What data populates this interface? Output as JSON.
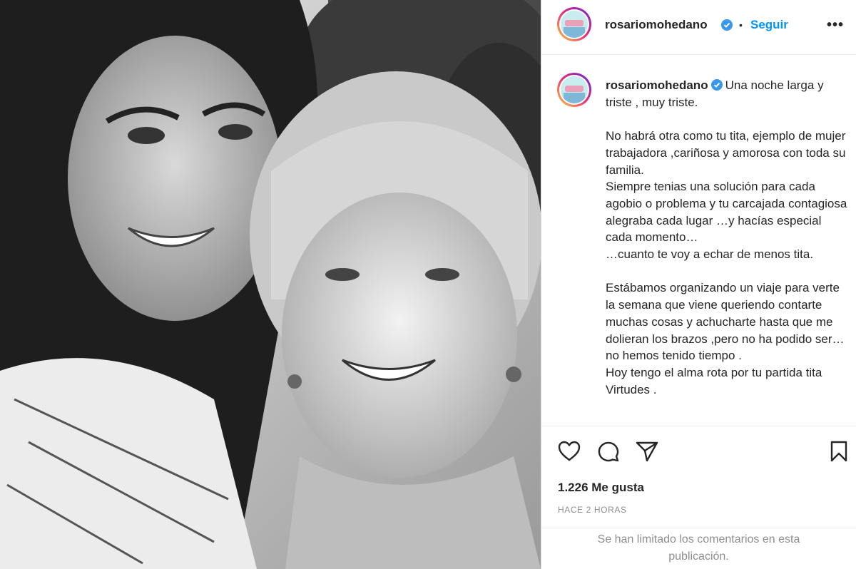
{
  "post": {
    "username": "rosariomohedano",
    "verified": true,
    "follow_label": "Seguir",
    "separator": "•",
    "more_label": "•••",
    "caption_text": "Una noche larga y triste , muy triste.\n\nNo habrá otra como tu tita, ejemplo de mujer trabajadora ,cariñosa y amorosa con toda su familia.\nSiempre tenias una solución para cada agobio o problema y tu carcajada contagiosa alegraba cada lugar …y hacías especial cada momento…\n…cuanto te voy a echar de menos tita.\n\nEstábamos organizando un viaje para verte la semana que viene queriendo contarte muchas cosas y achucharte hasta que me dolieran los brazos ,pero no ha podido ser…no hemos tenido tiempo .\nHoy tengo el alma rota por tu partida tita Virtudes .",
    "likes": "1.226 Me gusta",
    "time": "HACE 2 HORAS",
    "comments_limited": [
      "Se han limitado los comentarios en esta",
      "publicación."
    ]
  },
  "icons": {
    "like": "heart-icon",
    "comment": "comment-bubble-icon",
    "share": "paper-plane-icon",
    "save": "bookmark-icon",
    "verified": "verified-badge-icon",
    "more": "more-options-icon"
  },
  "colors": {
    "link_blue": "#0095f6",
    "verified_blue": "#3897f0",
    "text": "#262626",
    "muted": "#8e8e8e",
    "border": "#efefef"
  }
}
